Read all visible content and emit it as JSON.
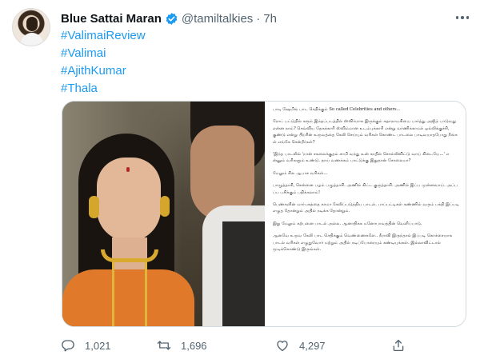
{
  "author": {
    "name": "Blue Sattai Maran",
    "handle": "@tamiltalkies",
    "separator": "·",
    "time": "7h"
  },
  "hashtags": [
    "#ValimaiReview",
    "#Valimai",
    "#AjithKumar",
    "#Thala"
  ],
  "media": {
    "text_paragraphs": [
      "பாடி ஷேமிங் பாட செதிக்கும் So called Celebrities and others...",
      "ரோட் பட்டுதில் கரூம் இந்தப்படத்தில் ஸ்விர்மாக இருக்கும் கதாநாயகியை பார்த்து அஜித் பாடுவது என்ன நாம்? செவ்விய தேகக்காரி ஸ்விம்மான உடம்புக்காரி என்று வர்ணிக்காமல் ஒல்லிக்குச்சி, குண்டு என்று பிறரின் உருவத்தை கேலி செய்யும் வரிகள் கொண்ட பாடலை பாடிவயாதபோது நீங்கள் எங்கே சென்றீர்கள்?",
      "'இந்த பாடலில் 'நான் சகலைக்குதம் சாமி வந்து உன் காதில் சொல்லிவிட்டு வாய் கிடையே...' என்னும் வரிகளும் உண்டு. தாய் வணக்கம் பாட்டுக்கு இதுதான் சோலையா?",
      "மேலும் சில ஆபாச வரிகள்...",
      "பாழுத்தாசி, சென்னை பழம் பழுத்தாசி. அணில் கிட்ட குருத்தாசி. அணில் இப்ப முன்னவாய். அப்பப்ப பசிக்கும் பதிக்கலாம்!",
      "பெண்களின் மார்பகத்தை காமா கேலிப்படுத்திய பாடல். பாப்பட்டிகள் கண்ணில் வரும் பக்தி இப்படி எழுத தோன்றும் அதில் நடிக்க தோன்றும்.",
      "இது மேலும் கற்பனை பாடல் அல்ல. ஆனாதிக்க மனோபாவத்தின் வெளிப்பாடு.",
      "ஆனவே உருவ கேலி பாட செதிக்கும் வெண்ணைகளே.. நீராவி இருந்தால் இப்படி கொச்சையாக பாடல் வரிகள் எழுதுவோர் மற்றும் அதில் நடிப்போரையும் கண்டியுங்கள். இல்லாவிட்டால் மூடிக்கொண்டு இருங்கள்."
    ]
  },
  "actions": {
    "replies": "1,021",
    "retweets": "1,696",
    "likes": "4,297"
  },
  "colors": {
    "link": "#1d9bf0",
    "secondary_text": "#536471",
    "verified": "#1d9bf0",
    "border": "#cfd9de"
  },
  "icons": [
    "verified-badge-icon",
    "more-icon",
    "reply-icon",
    "retweet-icon",
    "like-icon",
    "share-icon"
  ]
}
